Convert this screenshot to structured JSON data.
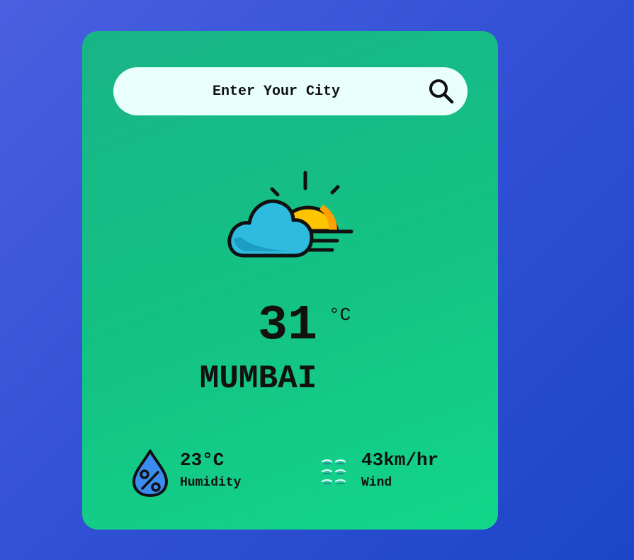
{
  "search": {
    "placeholder": "Enter Your City",
    "icon": "search-icon"
  },
  "weather": {
    "condition_icon": "cloud-sun-icon",
    "temperature": "31",
    "unit": "°C",
    "city": "MUMBAI"
  },
  "details": {
    "humidity": {
      "icon": "humidity-drop-icon",
      "value": "23°C",
      "label": "Humidity"
    },
    "wind": {
      "icon": "wind-icon",
      "value": "43km/hr",
      "label": "Wind"
    }
  },
  "colors": {
    "background": "#2f4fd4",
    "card": "#14c384",
    "search_bar": "#e8fffc",
    "cloud": "#2ebbe0",
    "sun": "#ffc400",
    "drop": "#3a8cf0"
  }
}
